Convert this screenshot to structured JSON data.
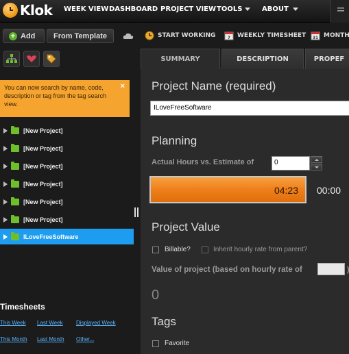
{
  "app": {
    "name": "Klok"
  },
  "nav": {
    "items": [
      {
        "label": "WEEK VIEW",
        "dropdown": false
      },
      {
        "label": "DASHBOARD",
        "dropdown": false
      },
      {
        "label": "PROJECT VIEW",
        "dropdown": false
      },
      {
        "label": "TOOLS",
        "dropdown": true
      },
      {
        "label": "ABOUT",
        "dropdown": true
      }
    ]
  },
  "toolbar": {
    "add_label": "Add",
    "from_template_label": "From Template",
    "start_working_label": "START WORKING",
    "weekly_timesheet_label": "WEEKLY TIMESHEET",
    "monthly_label": "MONTHE"
  },
  "tip": {
    "text": "You can now search by name, code, description or tag from the tag search view.",
    "close": "×"
  },
  "projects": [
    {
      "name": "[New Project]",
      "selected": false
    },
    {
      "name": "[New Project]",
      "selected": false
    },
    {
      "name": "[New Project]",
      "selected": false
    },
    {
      "name": "[New Project]",
      "selected": false
    },
    {
      "name": "[New Project]",
      "selected": false
    },
    {
      "name": "[New Project]",
      "selected": false
    },
    {
      "name": "ILoveFreeSoftware",
      "selected": true
    }
  ],
  "timesheets": {
    "title": "Timesheets",
    "links": [
      "This Week",
      "Last Week",
      "Displayed Week",
      "This Month",
      "Last Month",
      "Other..."
    ]
  },
  "tabs": [
    "SUMMARY",
    "DESCRIPTION",
    "PROPEF"
  ],
  "summary": {
    "project_name_heading": "Project Name (required)",
    "project_name_value": "ILoveFreeSoftware",
    "planning_heading": "Planning",
    "hours_label": "Actual Hours vs. Estimate of",
    "estimate_value": "0",
    "actual_time": "04:23",
    "estimate_time": "00:00",
    "progress_fill": 1.0,
    "value_heading": "Project Value",
    "billable_label": "Billable?",
    "inherit_label": "Inherit hourly rate from parent?",
    "value_label": "Value of project (based on hourly rate of",
    "value_suffix": ")",
    "value_amount": "0",
    "tags_heading": "Tags",
    "favorite_label": "Favorite"
  },
  "colors": {
    "accent": "#1d9cf0",
    "tip": "#f5a430",
    "progress": "#ee7f1a",
    "folder": "#6fbf2a"
  }
}
